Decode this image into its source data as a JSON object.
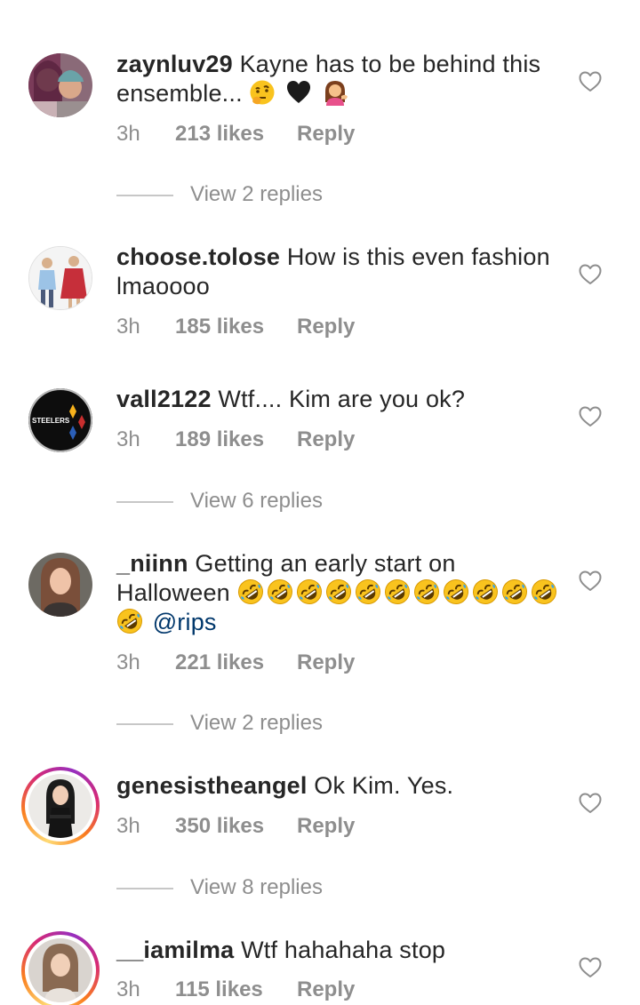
{
  "comments": [
    {
      "username": "zaynluv29",
      "text": "Kayne has to be behind this ensemble...",
      "emojis": [
        "thinking-face-emoji",
        "black-heart-emoji",
        "person-tipping-hand-emoji"
      ],
      "time": "3h",
      "likes": "213 likes",
      "reply": "Reply",
      "view_replies": "View 2 replies"
    },
    {
      "username": "choose.tolose",
      "text": "How is this even fashion lmaoooo",
      "time": "3h",
      "likes": "185 likes",
      "reply": "Reply"
    },
    {
      "username": "vall2122",
      "text": "Wtf.... Kim are you ok?",
      "avatar_text": "STEELERS",
      "time": "3h",
      "likes": "189 likes",
      "reply": "Reply",
      "view_replies": "View 6 replies"
    },
    {
      "username": "_niinn",
      "text": "Getting an early start on Halloween",
      "emojis": [
        "rolling-on-floor-laughing-emoji"
      ],
      "mention": "@rips",
      "time": "3h",
      "likes": "221 likes",
      "reply": "Reply",
      "view_replies": "View 2 replies"
    },
    {
      "username": "genesistheangel",
      "text": "Ok Kim. Yes.",
      "time": "3h",
      "likes": "350 likes",
      "reply": "Reply",
      "view_replies": "View 8 replies"
    },
    {
      "username": "__iamilma",
      "text": "Wtf hahahaha stop",
      "time": "3h",
      "likes": "115 likes",
      "reply": "Reply"
    }
  ],
  "colors": {
    "text": "#262626",
    "meta": "#8e8e8e",
    "mention": "#00376b",
    "divider": "#c7c7c7"
  }
}
